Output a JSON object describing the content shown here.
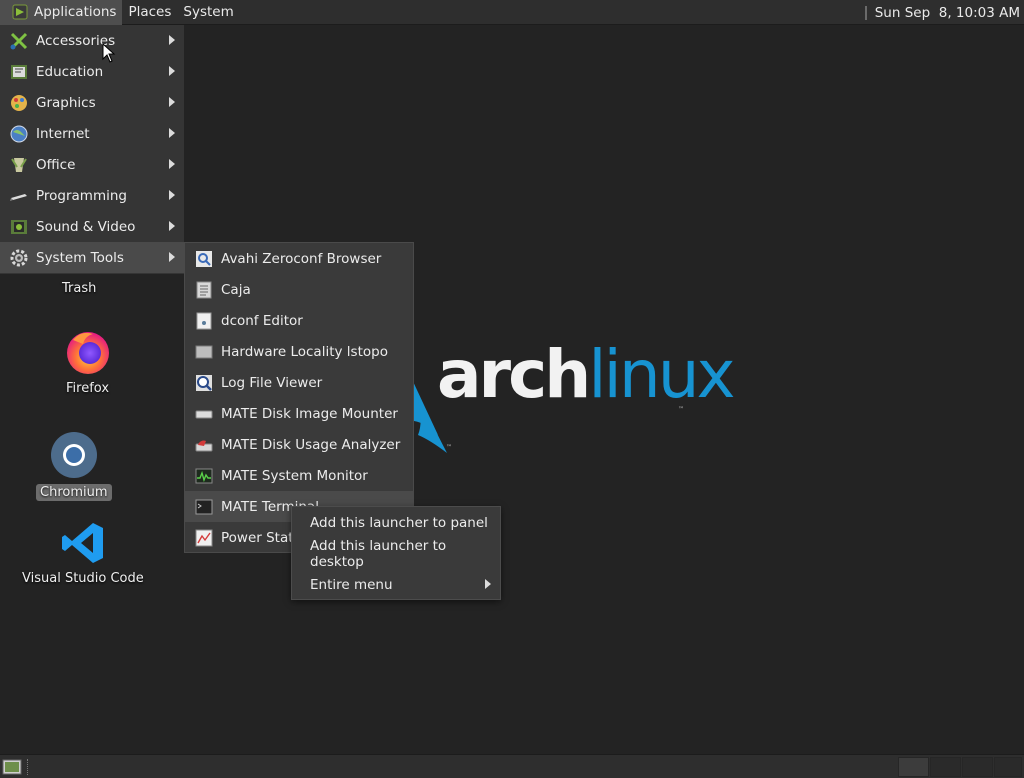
{
  "top_panel": {
    "applications_label": "Applications",
    "places_label": "Places",
    "system_label": "System",
    "clock": "Sun Sep  8, 10:03 AM"
  },
  "desktop": {
    "icons": [
      {
        "label": "Trash"
      },
      {
        "label": "Firefox"
      },
      {
        "label": "Chromium"
      },
      {
        "label": "Visual Studio Code"
      }
    ],
    "logo": {
      "arch": "arch",
      "linux": "linux"
    }
  },
  "main_menu": {
    "items": [
      {
        "label": "Accessories",
        "icon": "accessories-icon"
      },
      {
        "label": "Education",
        "icon": "education-icon"
      },
      {
        "label": "Graphics",
        "icon": "graphics-icon"
      },
      {
        "label": "Internet",
        "icon": "internet-icon"
      },
      {
        "label": "Office",
        "icon": "office-icon"
      },
      {
        "label": "Programming",
        "icon": "programming-icon"
      },
      {
        "label": "Sound & Video",
        "icon": "sound-video-icon"
      },
      {
        "label": "System Tools",
        "icon": "gear-icon",
        "highlighted": true
      }
    ]
  },
  "system_tools_menu": {
    "items": [
      {
        "label": "Avahi Zeroconf Browser"
      },
      {
        "label": "Caja"
      },
      {
        "label": "dconf Editor"
      },
      {
        "label": "Hardware Locality lstopo"
      },
      {
        "label": "Log File Viewer"
      },
      {
        "label": "MATE Disk Image Mounter"
      },
      {
        "label": "MATE Disk Usage Analyzer"
      },
      {
        "label": "MATE System Monitor"
      },
      {
        "label": "MATE Terminal",
        "highlighted": true
      },
      {
        "label": "Power Statis"
      }
    ]
  },
  "context_menu": {
    "items": [
      {
        "label": "Add this launcher to panel"
      },
      {
        "label": "Add this launcher to desktop"
      },
      {
        "label": "Entire menu"
      }
    ]
  },
  "colors": {
    "arch_blue": "#1793d1",
    "panel_bg": "#2e2e2e",
    "desktop_bg": "#232323"
  }
}
